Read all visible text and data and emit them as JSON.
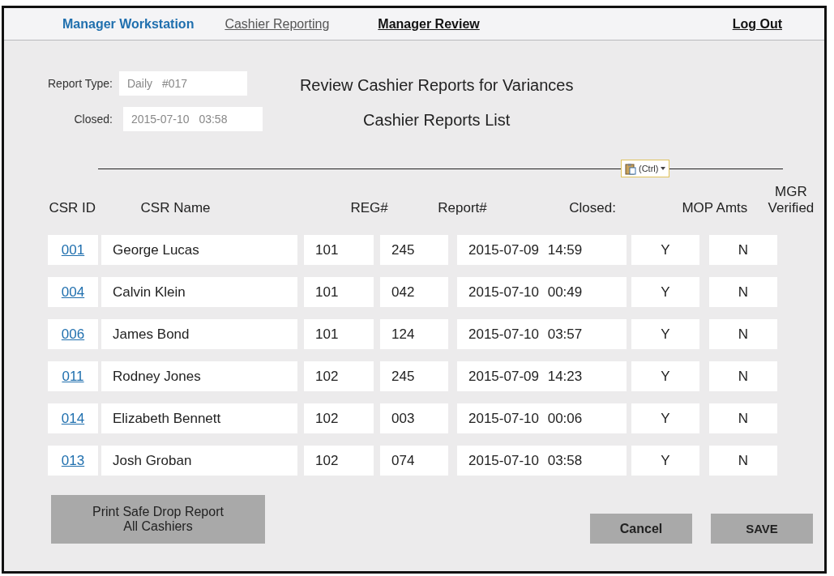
{
  "nav": {
    "brand": "Manager Workstation",
    "tabs": [
      {
        "label": "Cashier Reporting",
        "selected": false
      },
      {
        "label": "Manager Review",
        "selected": true
      }
    ],
    "logout": "Log Out"
  },
  "report_info": {
    "report_type_label": "Report Type:",
    "report_type": "Daily #017",
    "closed_label": "Closed:",
    "closed": "2015-07-10 03:58"
  },
  "title": "Review Cashier Reports for Variances",
  "subtitle": "Cashier Reports List",
  "paste_options": {
    "label": "(Ctrl)"
  },
  "table": {
    "columns": [
      "CSR ID",
      "CSR Name",
      "REG#",
      "Report#",
      "Closed:",
      "MOP Amts",
      "MGR Verified"
    ],
    "rows": [
      {
        "csr_id": "001",
        "name": "George Lucas",
        "reg": "101",
        "report": "245",
        "closed": "2015-07-09 14:59",
        "mop": "Y",
        "verified": "N"
      },
      {
        "csr_id": "004",
        "name": "Calvin Klein",
        "reg": "101",
        "report": "042",
        "closed": "2015-07-10 00:49",
        "mop": "Y",
        "verified": "N"
      },
      {
        "csr_id": "006",
        "name": "James Bond",
        "reg": "101",
        "report": "124",
        "closed": "2015-07-10 03:57",
        "mop": "Y",
        "verified": "N"
      },
      {
        "csr_id": "011",
        "name": "Rodney Jones",
        "reg": "102",
        "report": "245",
        "closed": "2015-07-09 14:23",
        "mop": "Y",
        "verified": "N"
      },
      {
        "csr_id": "014",
        "name": "Elizabeth Bennett",
        "reg": "102",
        "report": "003",
        "closed": "2015-07-10 00:06",
        "mop": "Y",
        "verified": "N"
      },
      {
        "csr_id": "013",
        "name": "Josh Groban",
        "reg": "102",
        "report": "074",
        "closed": "2015-07-10 03:58",
        "mop": "Y",
        "verified": "N"
      }
    ]
  },
  "buttons": {
    "print": "Print Safe Drop Report\nAll Cashiers",
    "cancel": "Cancel",
    "save": "SAVE"
  }
}
